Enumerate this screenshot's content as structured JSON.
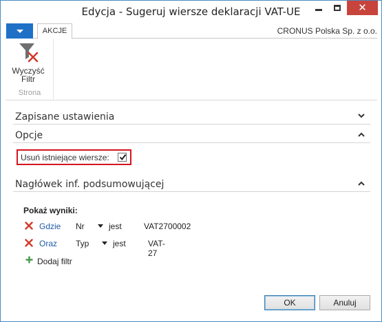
{
  "window": {
    "title": "Edycja - Sugeruj wiersze deklaracji VAT-UE"
  },
  "ribbon": {
    "tab_label": "AKCJE",
    "company": "CRONUS Polska Sp. z o.o.",
    "clear_filter_line1": "Wyczyść",
    "clear_filter_line2": "Filtr",
    "group_label": "Strona"
  },
  "fasttabs": {
    "saved_settings": "Zapisane ustawienia",
    "options": "Opcje",
    "summary_header": "Nagłówek inf. podsumowującej"
  },
  "options": {
    "delete_existing_label": "Usuń istniejące wiersze:",
    "delete_existing_checked": true
  },
  "filters": {
    "title": "Pokaż wyniki:",
    "rows": [
      {
        "connector": "Gdzie",
        "field": "Nr",
        "operator": "jest",
        "value": "VAT2700002"
      },
      {
        "connector": "Oraz",
        "field": "Typ",
        "operator": "jest",
        "value": "VAT-27"
      }
    ],
    "add_label": "Dodaj filtr"
  },
  "buttons": {
    "ok": "OK",
    "cancel": "Anuluj"
  },
  "colors": {
    "accent": "#1e71c6",
    "close": "#c7443c",
    "highlight_border": "#d4141c",
    "link": "#1e5aa8",
    "remove_icon": "#d23a2a",
    "add_icon": "#4a9a4a"
  }
}
